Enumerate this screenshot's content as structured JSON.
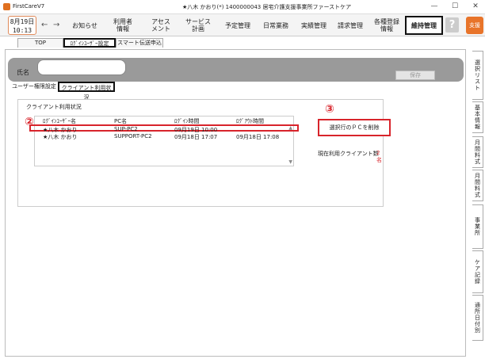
{
  "window": {
    "app_name": "FirstCareV7",
    "title": "★八木 かおり(*) 1400000043 居宅介護支援事業所ファーストケア",
    "minimize": "—",
    "maximize": "☐",
    "close": "✕"
  },
  "toolbar": {
    "date": "8月19日",
    "time": "10:13",
    "back_arrow": "←",
    "forward_arrow": "→",
    "menu": [
      {
        "label": "お知らせ"
      },
      {
        "label": "利用者\n情報"
      },
      {
        "label": "アセス\nメント"
      },
      {
        "label": "サービス\n計画"
      },
      {
        "label": "予定管理"
      },
      {
        "label": "日常業務"
      },
      {
        "label": "実績管理"
      },
      {
        "label": "請求管理"
      },
      {
        "label": "各種登録\n情報"
      },
      {
        "label": "維持管理"
      }
    ],
    "help": "?",
    "support": "支援"
  },
  "subtabs": [
    "TOP",
    "ﾛｸﾞｲﾝﾕｰｻﾞｰ設定",
    "スマート伝送申込"
  ],
  "panel": {
    "name_label": "氏名",
    "name_value": "",
    "save_label": "保存",
    "tabs": [
      "ユーザー権限設定",
      "クライアント利用状況"
    ],
    "client_title": "クライアント利用状況",
    "columns": [
      "ﾛｸﾞｲﾝﾕｰｻﾞｰ名",
      "PC名",
      "ﾛｸﾞｲﾝ時間",
      "ﾛｸﾞｱｳﾄ時間"
    ],
    "rows": [
      [
        "★八木 かおり",
        "SUP-PC2",
        "09月19日 10:00",
        ""
      ],
      [
        "★八木 かおり",
        "SUPPORT-PC2",
        "09月18日 17:07",
        "09月18日 17:08"
      ]
    ],
    "delete_label": "選択行のＰＣを削除",
    "count_label": "現在利用クライアント数",
    "count_value": "2名",
    "marker_2": "②",
    "marker_3": "③"
  },
  "side_tabs": [
    "選択リスト",
    "基本情報",
    "月間料式",
    "月間料式",
    "事業所",
    "ケア記録",
    "通所日付別"
  ]
}
